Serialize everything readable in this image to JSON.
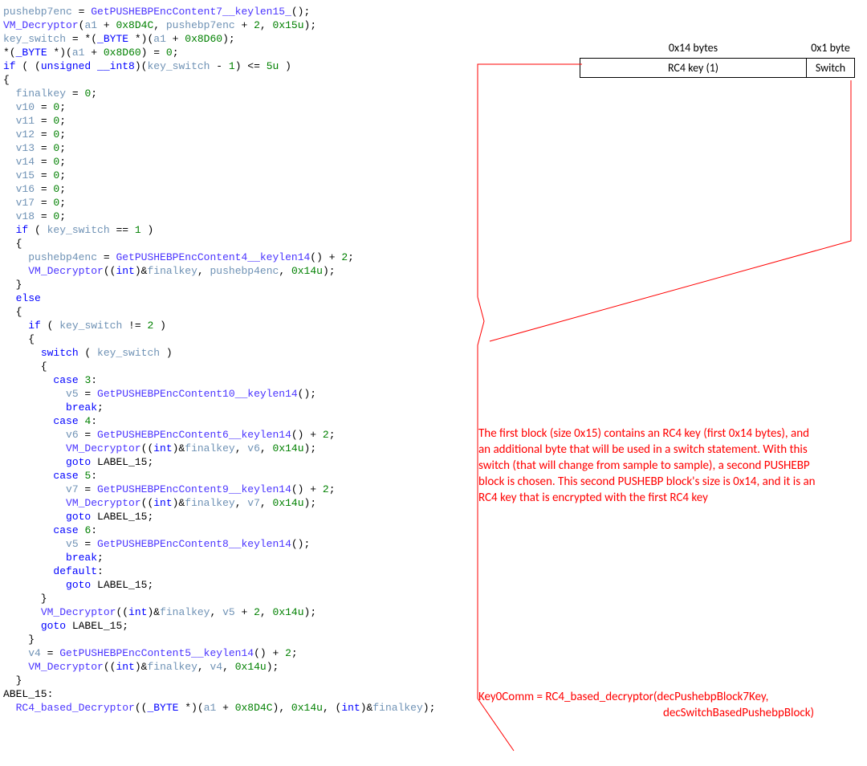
{
  "diag": {
    "h1": "0x14 bytes",
    "h2": "0x1 byte",
    "c1": "RC4 key (1)",
    "c2": "Switch"
  },
  "txt1": "The first block (size 0x15) contains an RC4 key (first 0x14 bytes), and an additional byte that will be used in a switch statement. With this switch (that will change from sample to sample), a second PUSHEBP block is chosen. This second PUSHEBP block's size is 0x14, and it is an RC4 key that is encrypted with the first RC4 key",
  "txt2_l1": "Key0Comm = RC4_based_decryptor(decPushebpBlock7Key,",
  "txt2_l2": "decSwitchBasedPushebpBlock)",
  "code": {
    "l1a": "pushebp7enc",
    "l1b": " = ",
    "l1c": "GetPUSHEBPEncContent7__keylen15_",
    "l1d": "();",
    "l2a": "VM_Decryptor",
    "l2b": "(",
    "l2c": "a1",
    "l2d": " + ",
    "l2e": "0x8D4C",
    "l2f": ", ",
    "l2g": "pushebp7enc",
    "l2h": " + ",
    "l2i": "2",
    "l2j": ", ",
    "l2k": "0x15u",
    "l2l": ");",
    "l3a": "key_switch",
    "l3b": " = *(",
    "l3c": "_BYTE",
    "l3d": " *)(",
    "l3e": "a1",
    "l3f": " + ",
    "l3g": "0x8D60",
    "l3h": ");",
    "l4a": "*(",
    "l4b": "_BYTE",
    "l4c": " *)(",
    "l4d": "a1",
    "l4e": " + ",
    "l4f": "0x8D60",
    "l4g": ") = ",
    "l4h": "0",
    "l4i": ";",
    "l5a": "if",
    "l5b": " ( (",
    "l5c": "unsigned __int8",
    "l5d": ")(",
    "l5e": "key_switch",
    "l5f": " - ",
    "l5g": "1",
    "l5h": ") <= ",
    "l5i": "5u",
    "l5j": " )",
    "l7a": "finalkey",
    "l7b": " = ",
    "l7c": "0",
    "l7d": ";",
    "l8a": "v10",
    "l9a": "v11",
    "l10a": "v12",
    "l11a": "v13",
    "l12a": "v14",
    "l13a": "v15",
    "l14a": "v16",
    "l15a": "v17",
    "l16a": "v18",
    "eqz": " = ",
    "zero": "0",
    "semi": ";",
    "l17a": "if",
    "l17b": " ( ",
    "l17c": "key_switch",
    "l17d": " == ",
    "l17e": "1",
    "l17f": " )",
    "l19a": "pushebp4enc",
    "l19b": " = ",
    "l19c": "GetPUSHEBPEncContent4__keylen14",
    "l19d": "() + ",
    "l19e": "2",
    "l19f": ";",
    "l20a": "VM_Decryptor",
    "l20b": "((",
    "l20c": "int",
    "l20d": ")&",
    "l20e": "finalkey",
    "l20f": ", ",
    "l20g": "pushebp4enc",
    "l20h": ", ",
    "l20i": "0x14u",
    "l20j": ");",
    "l22": "else",
    "l24a": "if",
    "l24b": " ( ",
    "l24c": "key_switch",
    "l24d": " != ",
    "l24e": "2",
    "l24f": " )",
    "l26a": "switch",
    "l26b": " ( ",
    "l26c": "key_switch",
    "l26d": " )",
    "l28a": "case",
    "l28b": " 3",
    "l29a": "v5",
    "l29b": " = ",
    "l29c": "GetPUSHEBPEncContent10__keylen14",
    "l29d": "();",
    "l30": "break",
    "l31a": "case",
    "l31b": " 4",
    "l32a": "v6",
    "l32b": " = ",
    "l32c": "GetPUSHEBPEncContent6__keylen14",
    "l32d": "() + ",
    "l32e": "2",
    "l32f": ";",
    "l33a": "VM_Decryptor",
    "l33b": "((",
    "l33c": "int",
    "l33d": ")&",
    "l33e": "finalkey",
    "l33f": ", ",
    "l33g": "v6",
    "l33h": ", ",
    "l33i": "0x14u",
    "l33j": ");",
    "l34a": "goto",
    "l34b": " LABEL_15;",
    "l35a": "case",
    "l35b": " 5",
    "l36a": "v7",
    "l36b": " = ",
    "l36c": "GetPUSHEBPEncContent9__keylen14",
    "l36d": "() + ",
    "l36e": "2",
    "l36f": ";",
    "l37a": "VM_Decryptor",
    "l37b": "((",
    "l37c": "int",
    "l37d": ")&",
    "l37e": "finalkey",
    "l37f": ", ",
    "l37g": "v7",
    "l37h": ", ",
    "l37i": "0x14u",
    "l37j": ");",
    "l38a": "goto",
    "l38b": " LABEL_15;",
    "l39a": "case",
    "l39b": " 6",
    "l40a": "v5",
    "l40b": " = ",
    "l40c": "GetPUSHEBPEncContent8__keylen14",
    "l40d": "();",
    "l41": "break",
    "l42a": "default",
    "l42b": ":",
    "l43a": "goto",
    "l43b": " LABEL_15;",
    "l45a": "VM_Decryptor",
    "l45b": "((",
    "l45c": "int",
    "l45d": ")&",
    "l45e": "finalkey",
    "l45f": ", ",
    "l45g": "v5",
    "l45h": " + ",
    "l45i": "2",
    "l45j": ", ",
    "l45k": "0x14u",
    "l45l": ");",
    "l46a": "goto",
    "l46b": " LABEL_15;",
    "l48a": "v4",
    "l48b": " = ",
    "l48c": "GetPUSHEBPEncContent5__keylen14",
    "l48d": "() + ",
    "l48e": "2",
    "l48f": ";",
    "l49a": "VM_Decryptor",
    "l49b": "((",
    "l49c": "int",
    "l49d": ")&",
    "l49e": "finalkey",
    "l49f": ", ",
    "l49g": "v4",
    "l49h": ", ",
    "l49i": "0x14u",
    "l49j": ");",
    "l51": "ABEL_15:",
    "l52a": "RC4_based_Decryptor",
    "l52b": "((",
    "l52c": "_BYTE",
    "l52d": " *)(",
    "l52e": "a1",
    "l52f": " + ",
    "l52g": "0x8D4C",
    "l52h": "), ",
    "l52i": "0x14u",
    "l52j": ", (",
    "l52k": "int",
    "l52l": ")&",
    "l52m": "finalkey",
    "l52n": ");"
  }
}
